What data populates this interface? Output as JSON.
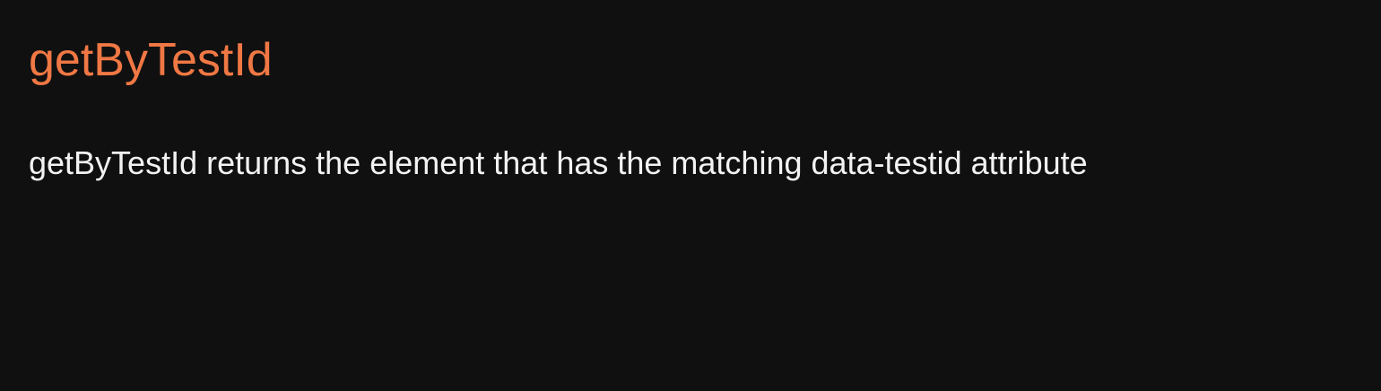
{
  "slide": {
    "title": "getByTestId",
    "body": "getByTestId returns the element that has the matching data-testid attribute"
  },
  "colors": {
    "background": "#101010",
    "title": "#f07844",
    "text": "#f2f2f2"
  }
}
